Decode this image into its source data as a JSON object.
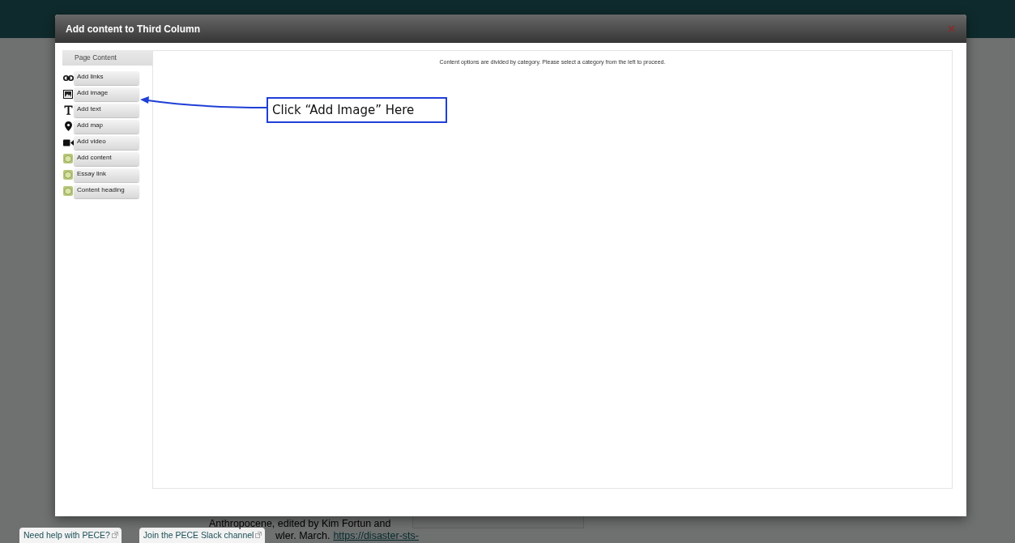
{
  "dialog": {
    "title": "Add content to Third Column",
    "sidebar": {
      "heading": "Page Content",
      "items": [
        {
          "kind": "link",
          "label": "Add links"
        },
        {
          "kind": "image",
          "label": "Add image"
        },
        {
          "kind": "text",
          "label": "Add text"
        },
        {
          "kind": "map",
          "label": "Add map"
        },
        {
          "kind": "video",
          "label": "Add video"
        },
        {
          "kind": "block",
          "label": "Add content"
        },
        {
          "kind": "block",
          "label": "Essay link"
        },
        {
          "kind": "block",
          "label": "Content heading"
        }
      ]
    },
    "message": "Content options are divided by category. Please select a category from the left to proceed."
  },
  "annotation": {
    "text": "Click “Add Image” Here"
  },
  "background_page": {
    "help_links": [
      "Need help with PECE?",
      "Join the PECE Slack channel"
    ],
    "text_lines": [
      "Anthropocene, edited by Kim Fortun and",
      "wler. March."
    ],
    "link": "https://disaster-sts-"
  }
}
